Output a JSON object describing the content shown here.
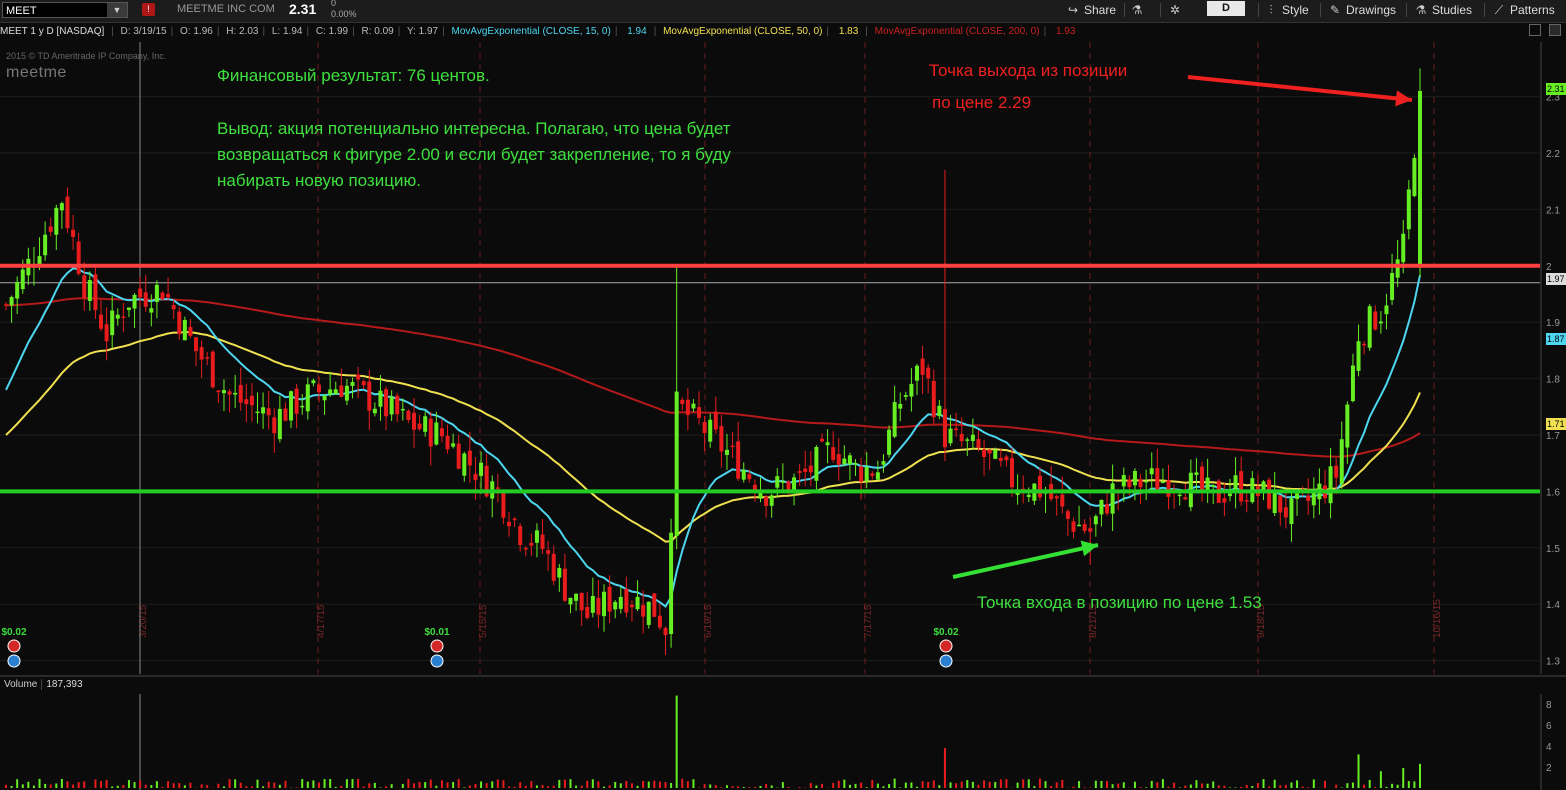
{
  "toolbar": {
    "symbol": "MEET",
    "company": "MEETME INC COM",
    "last": "2.31",
    "change_top": "0",
    "change_pct": "0.00%",
    "period_label": "D",
    "share_label": "Share",
    "style_label": "Style",
    "drawings_label": "Drawings",
    "studies_label": "Studies",
    "patterns_label": "Patterns"
  },
  "info": {
    "title": "MEET 1 y D [NASDAQ]",
    "date": "D: 3/19/15",
    "open": "O: 1.96",
    "high": "H: 2.03",
    "low": "L: 1.94",
    "close": "C: 1.99",
    "range": "R: 0.09",
    "y": "Y: 1.97",
    "ema15_label": "MovAvgExponential (CLOSE, 15, 0)",
    "ema15_value": "1.94",
    "ema50_label": "MovAvgExponential (CLOSE, 50, 0)",
    "ema50_value": "1.83",
    "ema200_label": "MovAvgExponential (CLOSE, 200, 0)",
    "ema200_value": "1.93"
  },
  "watermark": {
    "copyright": "2015 © TD Ameritrade IP Company, Inc.",
    "logo": "meetme"
  },
  "annotations": {
    "result": "Финансовый результат: 76 центов.",
    "conclusion_1": "Вывод: акция потенциально интересна. Полагаю, что цена будет",
    "conclusion_2": "возвращаться к фигуре 2.00 и если будет закрепление, то я буду",
    "conclusion_3": "набирать новую позицию.",
    "exit_1": "Точка выхода из позиции",
    "exit_2": "по цене 2.29",
    "entry": "Точка входа в позицию  по цене 1.53"
  },
  "colors": {
    "up": "#66ee22",
    "down": "#e81c1c",
    "ema15": "#4dd6f0",
    "ema50": "#f0e050",
    "ema200": "#b41a1a",
    "resistance": "#ff4040",
    "support": "#22cc22"
  },
  "price_tags": {
    "last": "2.31",
    "y_line": "1.97",
    "ema15": "1.87",
    "ema50": "1.71"
  },
  "volume": {
    "label": "Volume",
    "value": "187,393",
    "axis": [
      "8",
      "6",
      "4",
      "2"
    ]
  },
  "chart_data": {
    "type": "candlestick",
    "y_ticks": [
      "2.3",
      "2.2",
      "2.1",
      "2",
      "1.9",
      "1.8",
      "1.7",
      "1.6",
      "1.5",
      "1.4",
      "1.3"
    ],
    "ylim": [
      1.28,
      2.38
    ],
    "x_ticks": [
      "3/20/15",
      "4/17/15",
      "5/15/15",
      "6/19/15",
      "7/17/15",
      "8/21/15",
      "9/18/15",
      "10/16/15"
    ],
    "dividends": [
      "$0.02",
      "$0.01",
      "$0.02"
    ],
    "horizontal_levels": {
      "resistance": 2.0,
      "support": 1.6,
      "y_line": 1.97
    },
    "anchors": [
      [
        0,
        1.93
      ],
      [
        5,
        2.02
      ],
      [
        10,
        2.12
      ],
      [
        14,
        1.97
      ],
      [
        18,
        1.88
      ],
      [
        22,
        1.94
      ],
      [
        28,
        1.96
      ],
      [
        34,
        1.85
      ],
      [
        40,
        1.77
      ],
      [
        48,
        1.73
      ],
      [
        54,
        1.77
      ],
      [
        60,
        1.79
      ],
      [
        66,
        1.76
      ],
      [
        72,
        1.72
      ],
      [
        78,
        1.7
      ],
      [
        84,
        1.64
      ],
      [
        88,
        1.6
      ],
      [
        92,
        1.53
      ],
      [
        96,
        1.5
      ],
      [
        100,
        1.43
      ],
      [
        104,
        1.38
      ],
      [
        110,
        1.42
      ],
      [
        116,
        1.39
      ],
      [
        118,
        1.36
      ],
      [
        120,
        1.75
      ],
      [
        124,
        1.72
      ],
      [
        130,
        1.66
      ],
      [
        136,
        1.6
      ],
      [
        142,
        1.62
      ],
      [
        148,
        1.68
      ],
      [
        152,
        1.64
      ],
      [
        156,
        1.64
      ],
      [
        160,
        1.76
      ],
      [
        164,
        1.82
      ],
      [
        168,
        1.7
      ],
      [
        174,
        1.67
      ],
      [
        180,
        1.62
      ],
      [
        186,
        1.6
      ],
      [
        190,
        1.55
      ],
      [
        194,
        1.53
      ],
      [
        198,
        1.6
      ],
      [
        204,
        1.62
      ],
      [
        210,
        1.62
      ],
      [
        216,
        1.59
      ],
      [
        220,
        1.61
      ],
      [
        226,
        1.59
      ],
      [
        230,
        1.56
      ],
      [
        234,
        1.59
      ],
      [
        238,
        1.63
      ],
      [
        242,
        1.88
      ],
      [
        246,
        1.92
      ],
      [
        250,
        2.03
      ],
      [
        253,
        2.31
      ]
    ]
  }
}
